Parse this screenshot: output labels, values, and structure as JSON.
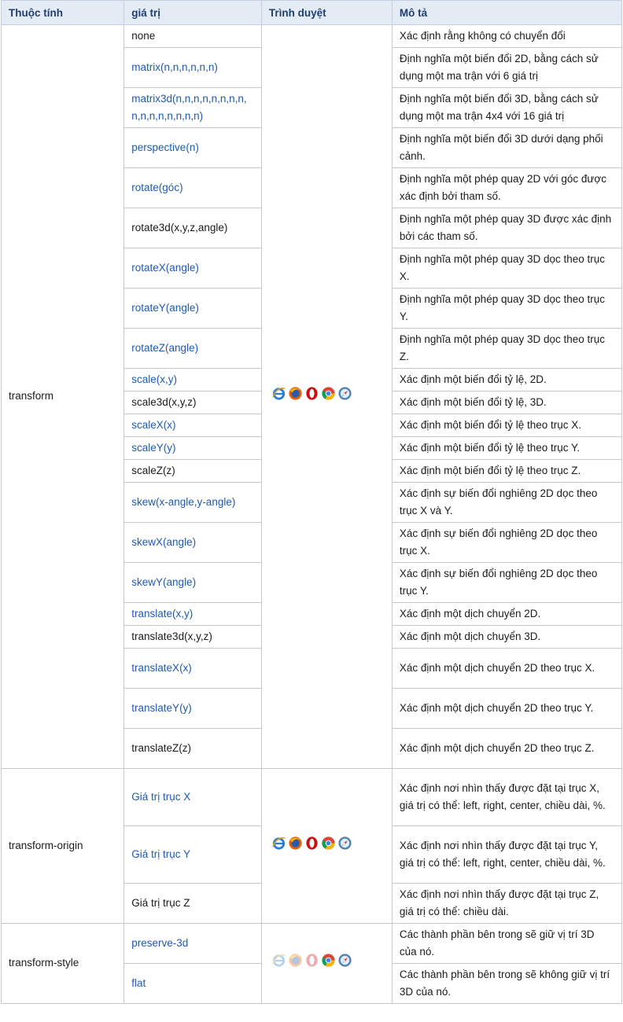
{
  "headers": {
    "property": "Thuộc tính",
    "value": "giá trị",
    "browser": "Trình duyệt",
    "description": "Mô tả"
  },
  "groups": [
    {
      "property": "transform",
      "browsers": [
        "ie-icon",
        "firefox-icon",
        "opera-icon",
        "chrome-icon",
        "safari-icon"
      ],
      "faded": [],
      "rows": [
        {
          "value": "none",
          "link": false,
          "desc": "Xác định rằng không có chuyển đổi"
        },
        {
          "value": "matrix(n,n,n,n,n,n)",
          "link": true,
          "desc": "Định nghĩa một biến đổi 2D, bằng cách sử dụng một ma trận với 6 giá trị"
        },
        {
          "value": "matrix3d(n,n,n,n,n,n,n,n,n,n,n,n,n,n,n,n)",
          "link": true,
          "desc": "Định nghĩa một biến đổi 3D, bằng cách sử dụng một ma trận 4x4 với 16 giá trị"
        },
        {
          "value": "perspective(n)",
          "link": true,
          "desc": "Định nghĩa một biến đổi 3D dưới dạng phối cảnh."
        },
        {
          "value": "rotate(góc)",
          "link": true,
          "desc": "Định nghĩa một phép quay 2D với góc được xác định bởi tham số."
        },
        {
          "value": "rotate3d(x,y,z,angle)",
          "link": false,
          "desc": "Định nghĩa một phép quay 3D được xác định bởi các tham số."
        },
        {
          "value": "rotateX(angle)",
          "link": true,
          "desc": "Định nghĩa một phép quay 3D dọc theo trục X."
        },
        {
          "value": "rotateY(angle)",
          "link": true,
          "desc": "Định nghĩa một phép quay 3D dọc theo trục Y."
        },
        {
          "value": "rotateZ(angle)",
          "link": true,
          "desc": "Định nghĩa một phép quay 3D dọc theo trục Z."
        },
        {
          "value": "scale(x,y)",
          "link": true,
          "desc": "Xác định một biến đổi tỷ lệ, 2D."
        },
        {
          "value": "scale3d(x,y,z)",
          "link": false,
          "desc": "Xác định một biến đổi tỷ lệ, 3D."
        },
        {
          "value": "scaleX(x)",
          "link": true,
          "desc": "Xác định một biến đổi tỷ lệ theo trục X."
        },
        {
          "value": "scaleY(y)",
          "link": true,
          "desc": "Xác định một biến đổi tỷ lệ theo trục Y."
        },
        {
          "value": "scaleZ(z)",
          "link": false,
          "desc": "Xác định một biến đổi tỷ lệ theo trục Z."
        },
        {
          "value": "skew(x-angle,y-angle)",
          "link": true,
          "desc": "Xác định sự biến đổi nghiêng 2D dọc theo trục X và Y."
        },
        {
          "value": "skewX(angle)",
          "link": true,
          "desc": "Xác định sự biến đổi nghiêng 2D dọc theo trục X."
        },
        {
          "value": "skewY(angle)",
          "link": true,
          "desc": "Xác định sự biến đổi nghiêng 2D dọc theo trục Y."
        },
        {
          "value": "translate(x,y)",
          "link": true,
          "desc": "Xác định một dịch chuyển 2D."
        },
        {
          "value": "translate3d(x,y,z)",
          "link": false,
          "desc": "Xác định một dịch chuyển 3D."
        },
        {
          "value": "translateX(x)",
          "link": true,
          "desc": "Xác định một dịch chuyển 2D theo trục X."
        },
        {
          "value": "translateY(y)",
          "link": true,
          "desc": "Xác định một dịch chuyển 2D theo trục Y."
        },
        {
          "value": "translateZ(z)",
          "link": false,
          "desc": "Xác định một dịch chuyển 2D theo trục Z."
        }
      ]
    },
    {
      "property": "transform-origin",
      "browsers": [
        "ie-icon",
        "firefox-icon",
        "opera-icon",
        "chrome-icon",
        "safari-icon"
      ],
      "faded": [],
      "rows": [
        {
          "value": "Giá trị trục X",
          "link": true,
          "desc": "Xác định nơi nhìn thấy được đặt tại trục X, giá trị có thể: left, right, center, chiều dài, %."
        },
        {
          "value": "Giá trị trục Y",
          "link": true,
          "desc": "Xác định nơi nhìn thấy được đặt tại trục Y, giá trị có thể: left, right, center, chiều dài, %."
        },
        {
          "value": "Giá trị trục Z",
          "link": false,
          "desc": "Xác định nơi nhìn thấy được đặt tại trục Z, giá trị có thể: chiều dài."
        }
      ]
    },
    {
      "property": "transform-style",
      "browsers": [
        "ie-icon",
        "firefox-icon",
        "opera-icon",
        "chrome-icon",
        "safari-icon"
      ],
      "faded": [
        "ie-icon",
        "firefox-icon",
        "opera-icon"
      ],
      "rows": [
        {
          "value": "preserve-3d",
          "link": true,
          "desc": "Các thành phần bên trong sẽ giữ vị trí 3D của nó."
        },
        {
          "value": "flat",
          "link": true,
          "desc": "Các thành phần bên trong sẽ không giữ vị trí 3D của nó."
        }
      ]
    }
  ],
  "colors": {
    "header_bg": "#e4ebf5",
    "header_text": "#1f3f6e",
    "link": "#1f5ab0",
    "border": "#c8c8c8"
  }
}
